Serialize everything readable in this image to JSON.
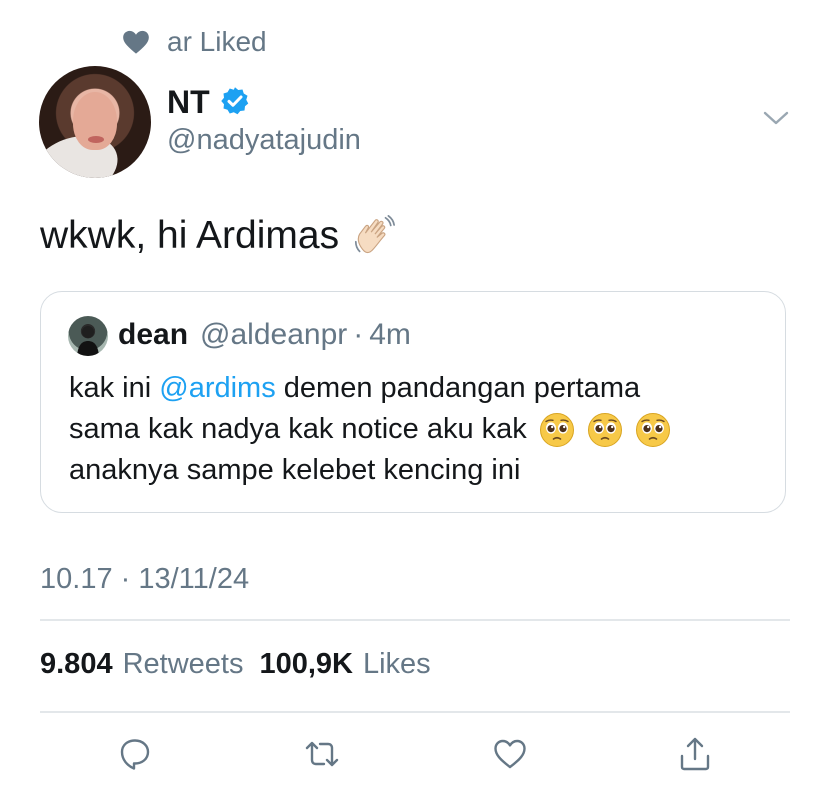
{
  "social_context": {
    "text": "ar Liked",
    "icon": "heart-icon"
  },
  "author": {
    "name": "NT",
    "handle": "@nadyatajudin",
    "verified": true
  },
  "tweet": {
    "text": "wkwk, hi Ardimas",
    "emoji": "waving-hand-icon"
  },
  "quote": {
    "name": "dean",
    "handle": "@aldeanpr",
    "separator": "·",
    "time": "4m",
    "line1_pre": "kak ini ",
    "mention": "@ardims",
    "line1_post": " demen pandangan pertama",
    "line2": "sama kak nadya kak notice aku kak",
    "line3": "anaknya sampe kelebet kencing ini",
    "emoji": "pleading-face-icon"
  },
  "timestamp": "10.17 · 13/11/24",
  "stats": {
    "retweets_count": "9.804",
    "retweets_label": "Retweets",
    "likes_count": "100,9K",
    "likes_label": "Likes"
  },
  "colors": {
    "secondary_text": "#657786",
    "accent": "#1da1f2",
    "border": "#d6dce1"
  }
}
